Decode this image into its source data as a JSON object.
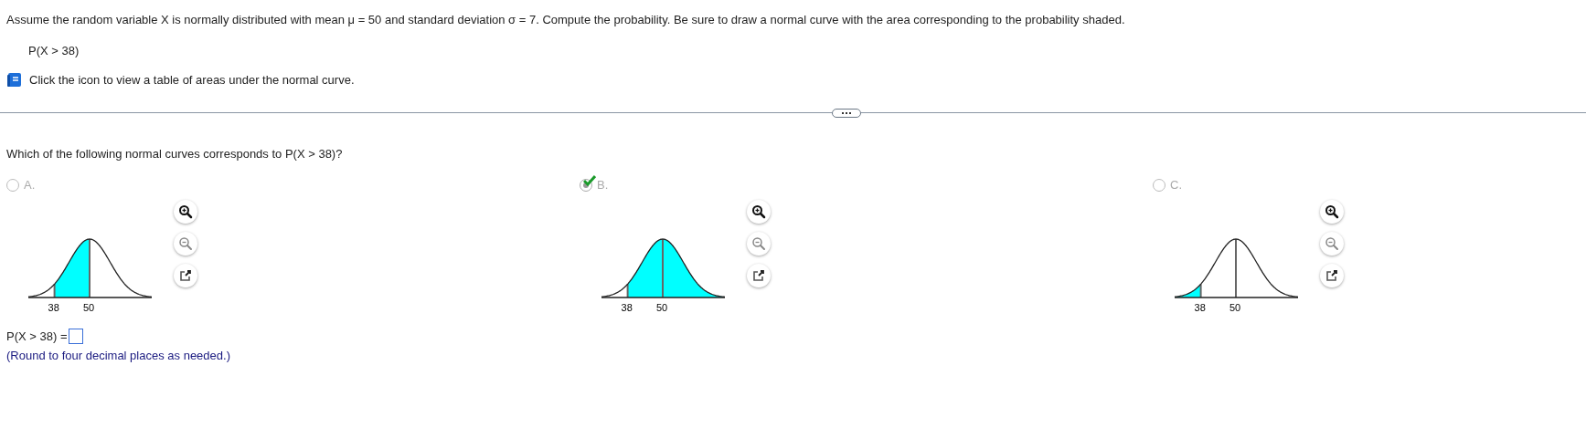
{
  "problem": {
    "statement": "Assume the random variable X is normally distributed with mean μ = 50 and standard deviation σ = 7. Compute the probability. Be sure to draw a normal curve with the area corresponding to the probability shaded.",
    "expression": "P(X > 38)",
    "table_link": "Click the icon to view a table of areas under the normal curve."
  },
  "question": "Which of the following normal curves corresponds to P(X > 38)?",
  "options": [
    {
      "label": "A.",
      "selected": false,
      "correct": false,
      "kind": "between",
      "ticks": [
        "38",
        "50"
      ]
    },
    {
      "label": "B.",
      "selected": true,
      "correct": true,
      "kind": "right",
      "ticks": [
        "38",
        "50"
      ]
    },
    {
      "label": "C.",
      "selected": false,
      "correct": false,
      "kind": "left",
      "ticks": [
        "38",
        "50"
      ]
    }
  ],
  "answer": {
    "prompt": "P(X > 38) =",
    "note": "(Round to four decimal places as needed.)"
  }
}
